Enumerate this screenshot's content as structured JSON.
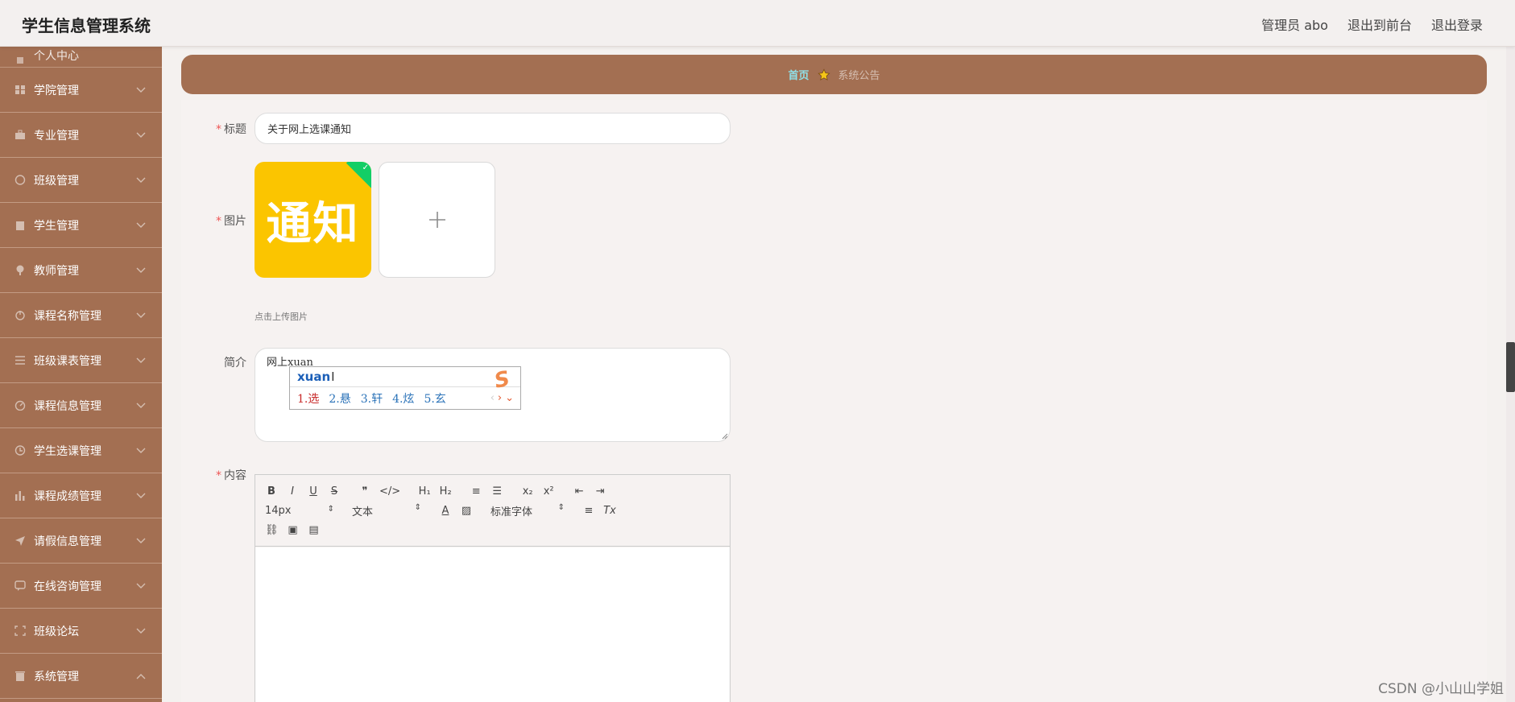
{
  "header": {
    "app_title": "学生信息管理系统",
    "user": "管理员 abo",
    "to_frontend": "退出到前台",
    "logout": "退出登录"
  },
  "sidebar": {
    "partial_item": "个人中心",
    "items": [
      {
        "label": "学院管理",
        "icon": "grid-icon"
      },
      {
        "label": "专业管理",
        "icon": "briefcase-icon"
      },
      {
        "label": "班级管理",
        "icon": "basketball-icon"
      },
      {
        "label": "学生管理",
        "icon": "clipboard-icon"
      },
      {
        "label": "教师管理",
        "icon": "pin-icon"
      },
      {
        "label": "课程名称管理",
        "icon": "power-icon"
      },
      {
        "label": "班级课表管理",
        "icon": "list-icon"
      },
      {
        "label": "课程信息管理",
        "icon": "dashboard-icon"
      },
      {
        "label": "学生选课管理",
        "icon": "clock-icon"
      },
      {
        "label": "课程成绩管理",
        "icon": "bar-chart-icon"
      },
      {
        "label": "请假信息管理",
        "icon": "send-icon"
      },
      {
        "label": "在线咨询管理",
        "icon": "chat-icon"
      },
      {
        "label": "班级论坛",
        "icon": "fullscreen-icon"
      },
      {
        "label": "系统管理",
        "icon": "trash-icon"
      }
    ]
  },
  "breadcrumb": {
    "home": "首页",
    "current": "系统公告"
  },
  "form": {
    "title_label": "标题",
    "title_value": "关于网上选课通知",
    "image_label": "图片",
    "image_text": "通知",
    "upload_tip": "点击上传图片",
    "summary_label": "简介",
    "summary_value": "网上xuan",
    "content_label": "内容"
  },
  "ime": {
    "input": "xuan",
    "candidates": [
      "1.选",
      "2.悬",
      "3.轩",
      "4.炫",
      "5.玄"
    ]
  },
  "editor": {
    "row1": [
      "B",
      "I",
      "U",
      "S",
      "❞",
      "</>",
      "H₁",
      "H₂",
      "≡",
      "☰",
      "x₂",
      "x²",
      "⇤",
      "⇥"
    ],
    "font_size": "14px",
    "format": "文本",
    "font_family": "标准字体",
    "clear_format": "Tx"
  },
  "watermark": "CSDN @小山山学姐",
  "colors": {
    "sidebar": "#a36f52",
    "breadcrumb_home": "#8fe0e8",
    "required": "#e55",
    "upload_image_bg": "#fbc500"
  }
}
